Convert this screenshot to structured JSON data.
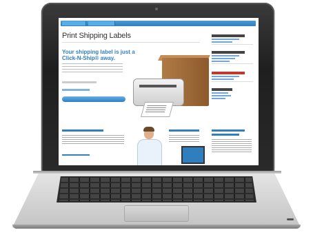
{
  "page": {
    "title": "Print Shipping Labels",
    "hero_headline": "Your shipping label is just a Click-N-Ship® away."
  },
  "colors": {
    "nav_blue": "#2f7fbf",
    "link_blue": "#6fa7dd",
    "accent_red": "#c0392b",
    "bezel": "#2a2a2a",
    "aluminum": "#cfcfcf"
  },
  "icons": [
    "printer-illustration",
    "shipping-box-illustration",
    "person-photo",
    "monitor-illustration"
  ]
}
